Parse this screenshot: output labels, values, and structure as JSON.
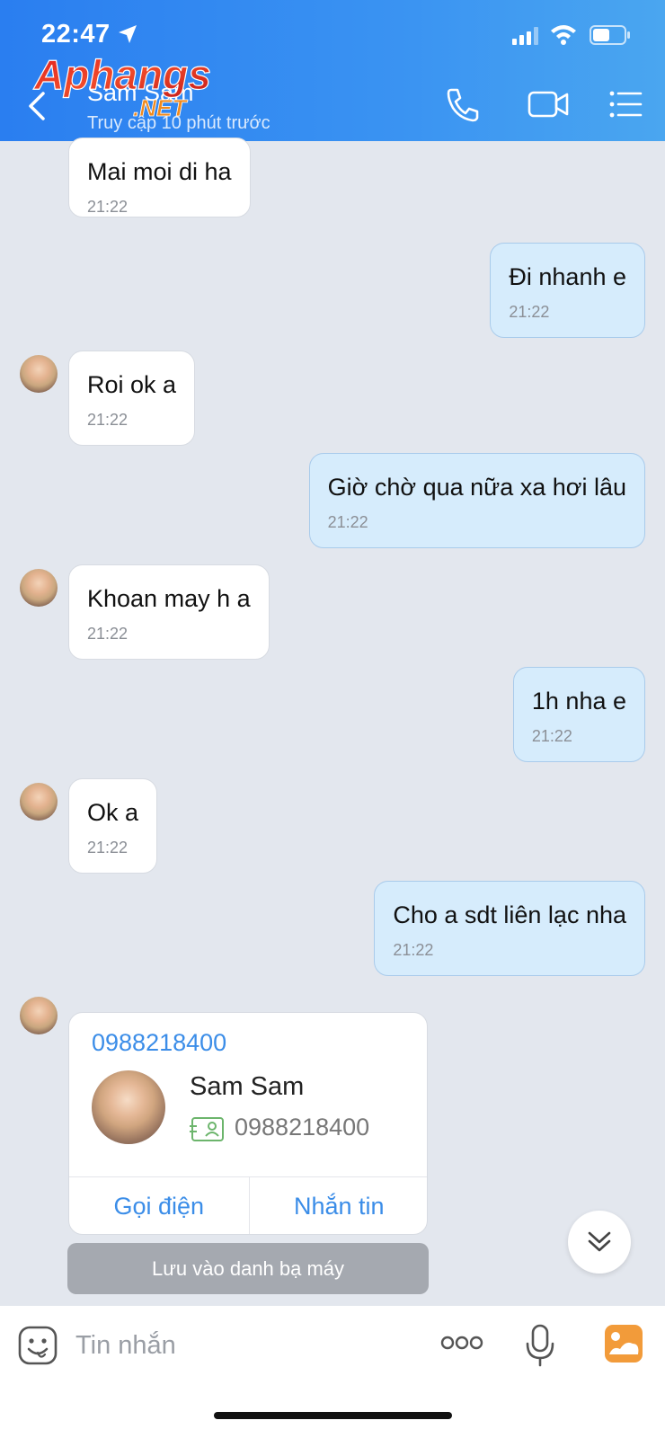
{
  "status_bar": {
    "time": "22:47"
  },
  "header": {
    "contact_name": "Sam Sam",
    "last_seen": "Truy cập 10 phút trước",
    "watermark": "Aphangs .NET"
  },
  "messages": [
    {
      "direction": "in",
      "text": "Mai moi di ha",
      "time": "21:22",
      "avatar": false
    },
    {
      "direction": "out",
      "text": "Đi nhanh e",
      "time": "21:22"
    },
    {
      "direction": "in",
      "text": "Roi ok a",
      "time": "21:22",
      "avatar": true
    },
    {
      "direction": "out",
      "text": "Giờ chờ qua nữa xa hơi lâu",
      "time": "21:22"
    },
    {
      "direction": "in",
      "text": "Khoan may h a",
      "time": "21:22",
      "avatar": true
    },
    {
      "direction": "out",
      "text": "1h nha e",
      "time": "21:22"
    },
    {
      "direction": "in",
      "text": "Ok a",
      "time": "21:22",
      "avatar": true
    },
    {
      "direction": "out",
      "text": "Cho a sdt liên lạc nha",
      "time": "21:22"
    }
  ],
  "contact_card": {
    "number": "0988218400",
    "name": "Sam Sam",
    "phone": "0988218400",
    "call_label": "Gọi điện",
    "message_label": "Nhắn tin",
    "save_label": "Lưu vào danh bạ máy"
  },
  "composer": {
    "placeholder": "Tin nhắn"
  },
  "colors": {
    "header": "#3a8ff2",
    "outgoing_bubble": "#d6ecfc",
    "link_blue": "#3b8de8",
    "chat_background": "#e3e7ee"
  },
  "icons": [
    "location-arrow-icon",
    "signal-icon",
    "wifi-icon",
    "battery-icon",
    "back-icon",
    "phone-icon",
    "video-icon",
    "menu-icon",
    "contact-id-icon",
    "chevron-double-down-icon",
    "emoji-icon",
    "more-icon",
    "microphone-icon",
    "gallery-icon"
  ]
}
